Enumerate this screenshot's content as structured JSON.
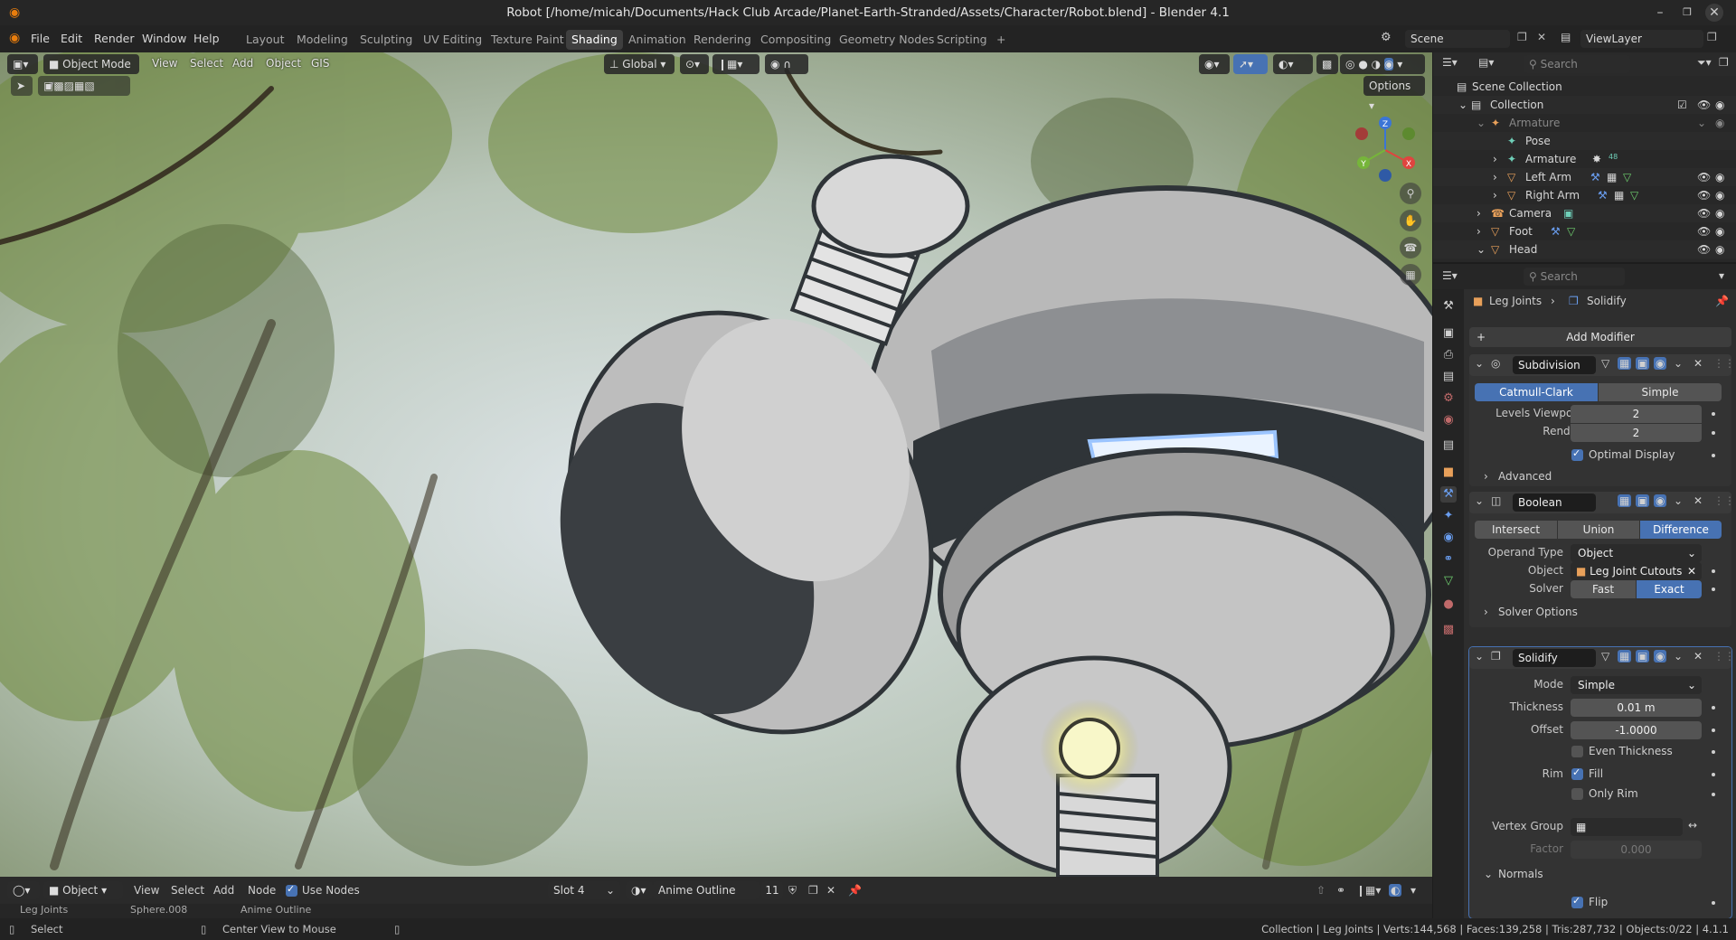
{
  "titlebar": {
    "title": "Robot [/home/micah/Documents/Hack Club Arcade/Planet-Earth-Stranded/Assets/Character/Robot.blend] - Blender 4.1"
  },
  "menubar": {
    "menus": [
      "File",
      "Edit",
      "Render",
      "Window",
      "Help"
    ],
    "workspaces": [
      "Layout",
      "Modeling",
      "Sculpting",
      "UV Editing",
      "Texture Paint",
      "Shading",
      "Animation",
      "Rendering",
      "Compositing",
      "Geometry Nodes",
      "Scripting"
    ],
    "active_workspace": "Shading",
    "add_tab": "+",
    "scene": "Scene",
    "view_layer": "ViewLayer"
  },
  "viewport": {
    "mode": "Object Mode",
    "menus": [
      "View",
      "Select",
      "Add",
      "Object",
      "GIS"
    ],
    "transform_orientation": "Global",
    "options_label": "Options",
    "gizmo_axes": {
      "z": "Z",
      "x": "X",
      "y": "Y"
    }
  },
  "outliner": {
    "search_placeholder": "Search",
    "rows": [
      {
        "label": "Scene Collection",
        "icon": "scene-collection-icon"
      },
      {
        "label": "Collection",
        "icon": "collection-icon"
      },
      {
        "label": "Armature",
        "icon": "armature-icon",
        "dim": true
      },
      {
        "label": "Pose",
        "icon": "pose-icon"
      },
      {
        "label": "Armature",
        "icon": "armature-data-icon",
        "badge": "48"
      },
      {
        "label": "Left Arm",
        "icon": "mesh-icon"
      },
      {
        "label": "Right Arm",
        "icon": "mesh-icon"
      },
      {
        "label": "Camera",
        "icon": "camera-icon"
      },
      {
        "label": "Foot",
        "icon": "mesh-icon"
      },
      {
        "label": "Head",
        "icon": "mesh-icon"
      }
    ]
  },
  "properties": {
    "search_placeholder": "Search",
    "breadcrumb": {
      "object": "Leg Joints",
      "modifier": "Solidify"
    },
    "add_modifier": "Add Modifier",
    "subdivision": {
      "name": "Subdivision",
      "types": [
        "Catmull-Clark",
        "Simple"
      ],
      "active_type": "Catmull-Clark",
      "levels_viewport_label": "Levels Viewport",
      "levels_viewport": "2",
      "render_label": "Render",
      "render": "2",
      "optimal_display_label": "Optimal Display",
      "optimal_display": true,
      "advanced_label": "Advanced"
    },
    "boolean": {
      "name": "Boolean",
      "ops": [
        "Intersect",
        "Union",
        "Difference"
      ],
      "active_op": "Difference",
      "operand_type_label": "Operand Type",
      "operand_type": "Object",
      "object_label": "Object",
      "object": "Leg Joint Cutouts",
      "solver_label": "Solver",
      "solvers": [
        "Fast",
        "Exact"
      ],
      "active_solver": "Exact",
      "solver_options_label": "Solver Options"
    },
    "solidify": {
      "name": "Solidify",
      "mode_label": "Mode",
      "mode": "Simple",
      "thickness_label": "Thickness",
      "thickness": "0.01 m",
      "offset_label": "Offset",
      "offset": "-1.0000",
      "even_thickness_label": "Even Thickness",
      "even_thickness": false,
      "rim_label": "Rim",
      "fill_label": "Fill",
      "fill": true,
      "only_rim_label": "Only Rim",
      "only_rim": false,
      "vertex_group_label": "Vertex Group",
      "factor_label": "Factor",
      "factor": "0.000",
      "normals_label": "Normals",
      "flip_label": "Flip",
      "flip": true
    }
  },
  "shader_header": {
    "editor_mode": "Object",
    "menus": [
      "View",
      "Select",
      "Add",
      "Node"
    ],
    "use_nodes_label": "Use Nodes",
    "slot": "Slot 4",
    "material": "Anime Outline",
    "users": "11"
  },
  "shader_breadcrumb": [
    "Leg Joints",
    "Sphere.008",
    "Anime Outline"
  ],
  "statusbar": {
    "left": "Select",
    "middle": "Center View to Mouse",
    "stats": "Collection | Leg Joints | Verts:144,568 | Faces:139,258 | Tris:287,732 | Objects:0/22 | 4.1.1"
  },
  "colors": {
    "accent": "#4772b3",
    "bg_dark": "#1d1d1d",
    "panel": "#333333",
    "axis_x": "#e0443f",
    "axis_y": "#76b53a",
    "axis_z": "#3b75d6"
  }
}
